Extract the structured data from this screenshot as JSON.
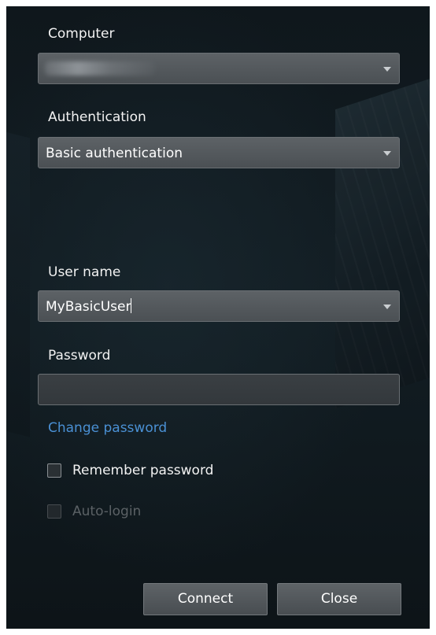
{
  "form": {
    "computer_label": "Computer",
    "computer_value": "",
    "auth_label": "Authentication",
    "auth_value": "Basic authentication",
    "username_label": "User name",
    "username_value": "MyBasicUser",
    "password_label": "Password",
    "password_value": "",
    "change_password_link": "Change password",
    "remember_password_label": "Remember password",
    "remember_password_checked": false,
    "auto_login_label": "Auto-login",
    "auto_login_checked": false,
    "auto_login_enabled": false
  },
  "buttons": {
    "connect_label": "Connect",
    "close_label": "Close"
  },
  "icons": {
    "dropdown": "chevron-down-icon",
    "checkbox": "checkbox-icon"
  },
  "colors": {
    "background": "#111a1f",
    "link": "#4a90d4",
    "text": "#f2f2f2",
    "disabled_text": "#5b6165"
  }
}
